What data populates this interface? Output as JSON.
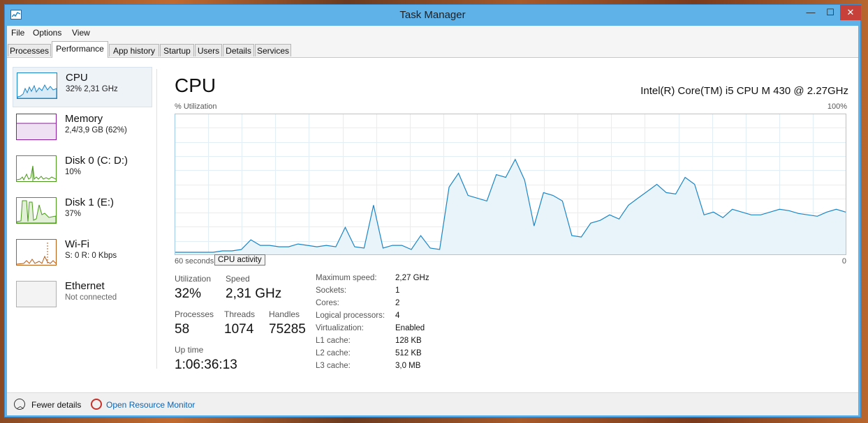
{
  "window": {
    "title": "Task Manager",
    "controls": {
      "minimize": "—",
      "maximize": "☐",
      "close": "✕"
    }
  },
  "menu": [
    "File",
    "Options",
    "View"
  ],
  "tabs": [
    "Processes",
    "Performance",
    "App history",
    "Startup",
    "Users",
    "Details",
    "Services"
  ],
  "active_tab": "Performance",
  "resources": [
    {
      "name": "CPU",
      "detail": "32% 2,31 GHz",
      "color": "#1a85c6"
    },
    {
      "name": "Memory",
      "detail": "2,4/3,9 GB (62%)",
      "color": "#8b1a9e"
    },
    {
      "name": "Disk 0 (C: D:)",
      "detail": "10%",
      "color": "#4a9a1a"
    },
    {
      "name": "Disk 1 (E:)",
      "detail": "37%",
      "color": "#4a9a1a"
    },
    {
      "name": "Wi-Fi",
      "detail": "S: 0 R: 0 Kbps",
      "color": "#b85a14"
    },
    {
      "name": "Ethernet",
      "detail": "Not connected",
      "color": "#a0a0a0"
    }
  ],
  "cpu": {
    "title": "CPU",
    "model": "Intel(R) Core(TM) i5 CPU M 430 @ 2.27GHz",
    "utilization_label": "% Utilization",
    "max_label": "100%",
    "time_label": "60 seconds",
    "zero_label": "0",
    "tooltip": "CPU activity",
    "history": [
      1,
      1,
      1,
      1,
      1,
      2,
      2,
      3,
      10,
      6,
      6,
      5,
      5,
      7,
      6,
      5,
      6,
      5,
      19,
      5,
      4,
      35,
      4,
      6,
      6,
      3,
      13,
      4,
      3,
      48,
      58,
      42,
      40,
      38,
      57,
      55,
      68,
      53,
      20,
      44,
      42,
      38,
      13,
      12,
      22,
      24,
      28,
      25,
      35,
      40,
      45,
      50,
      44,
      43,
      55,
      50,
      28,
      30,
      26,
      32,
      30,
      28,
      28,
      30,
      32,
      31,
      29,
      28,
      27,
      30,
      32,
      30
    ]
  },
  "stats": {
    "utilization": {
      "label": "Utilization",
      "value": "32%"
    },
    "speed": {
      "label": "Speed",
      "value": "2,31 GHz"
    },
    "processes": {
      "label": "Processes",
      "value": "58"
    },
    "threads": {
      "label": "Threads",
      "value": "1074"
    },
    "handles": {
      "label": "Handles",
      "value": "75285"
    },
    "uptime": {
      "label": "Up time",
      "value": "1:06:36:13"
    }
  },
  "specs": [
    {
      "label": "Maximum speed:",
      "value": "2,27 GHz"
    },
    {
      "label": "Sockets:",
      "value": "1"
    },
    {
      "label": "Cores:",
      "value": "2"
    },
    {
      "label": "Logical processors:",
      "value": "4"
    },
    {
      "label": "Virtualization:",
      "value": "Enabled"
    },
    {
      "label": "L1 cache:",
      "value": "128 KB"
    },
    {
      "label": "L2 cache:",
      "value": "512 KB"
    },
    {
      "label": "L3 cache:",
      "value": "3,0 MB"
    }
  ],
  "footer": {
    "fewer_details": "Fewer details",
    "open_resource_monitor": "Open Resource Monitor"
  }
}
